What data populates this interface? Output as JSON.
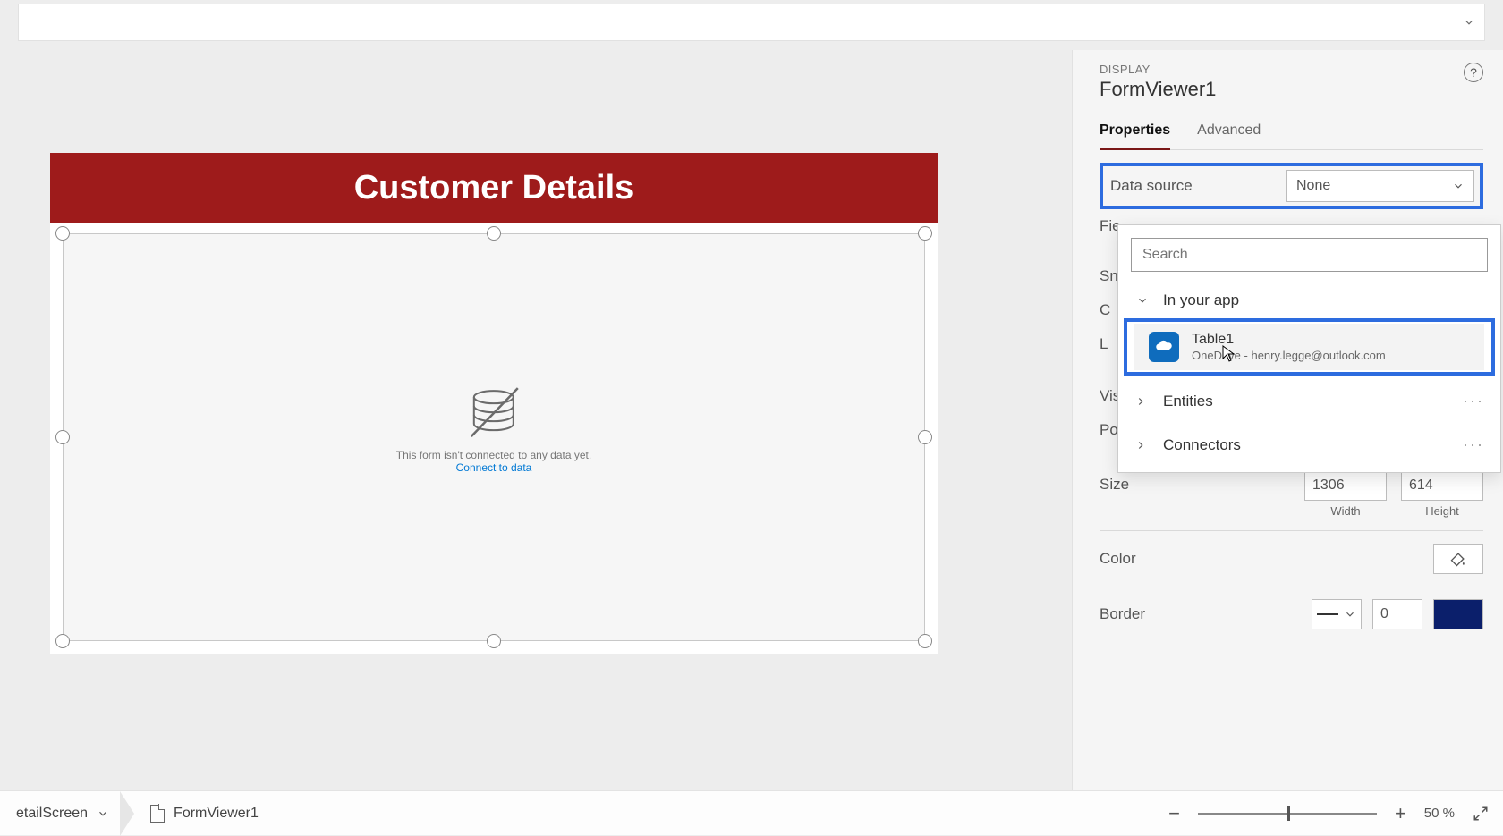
{
  "formula_bar": {
    "value": ""
  },
  "canvas": {
    "header_title": "Customer Details",
    "empty_message": "This form isn't connected to any data yet.",
    "connect_link": "Connect to data"
  },
  "panel": {
    "kicker": "DISPLAY",
    "title": "FormViewer1",
    "tabs": {
      "properties": "Properties",
      "advanced": "Advanced"
    },
    "data_source": {
      "label": "Data source",
      "value": "None"
    },
    "hidden_labels": {
      "fields": "Fie",
      "snap": "Sn",
      "columns": "C",
      "layout": "L",
      "visible": "Vis",
      "position": "Po"
    },
    "size": {
      "label": "Size",
      "width": "1306",
      "height": "614",
      "width_caption": "Width",
      "height_caption": "Height"
    },
    "color": {
      "label": "Color"
    },
    "border": {
      "label": "Border",
      "width": "0",
      "color": "#0b1f6b"
    }
  },
  "popup": {
    "search_placeholder": "Search",
    "group_in_app": "In your app",
    "item": {
      "name": "Table1",
      "subtitle": "OneDrive - henry.legge@outlook.com"
    },
    "entities": "Entities",
    "connectors": "Connectors"
  },
  "bottom": {
    "crumb1": "etailScreen",
    "crumb2": "FormViewer1",
    "zoom_label": "50  %"
  }
}
